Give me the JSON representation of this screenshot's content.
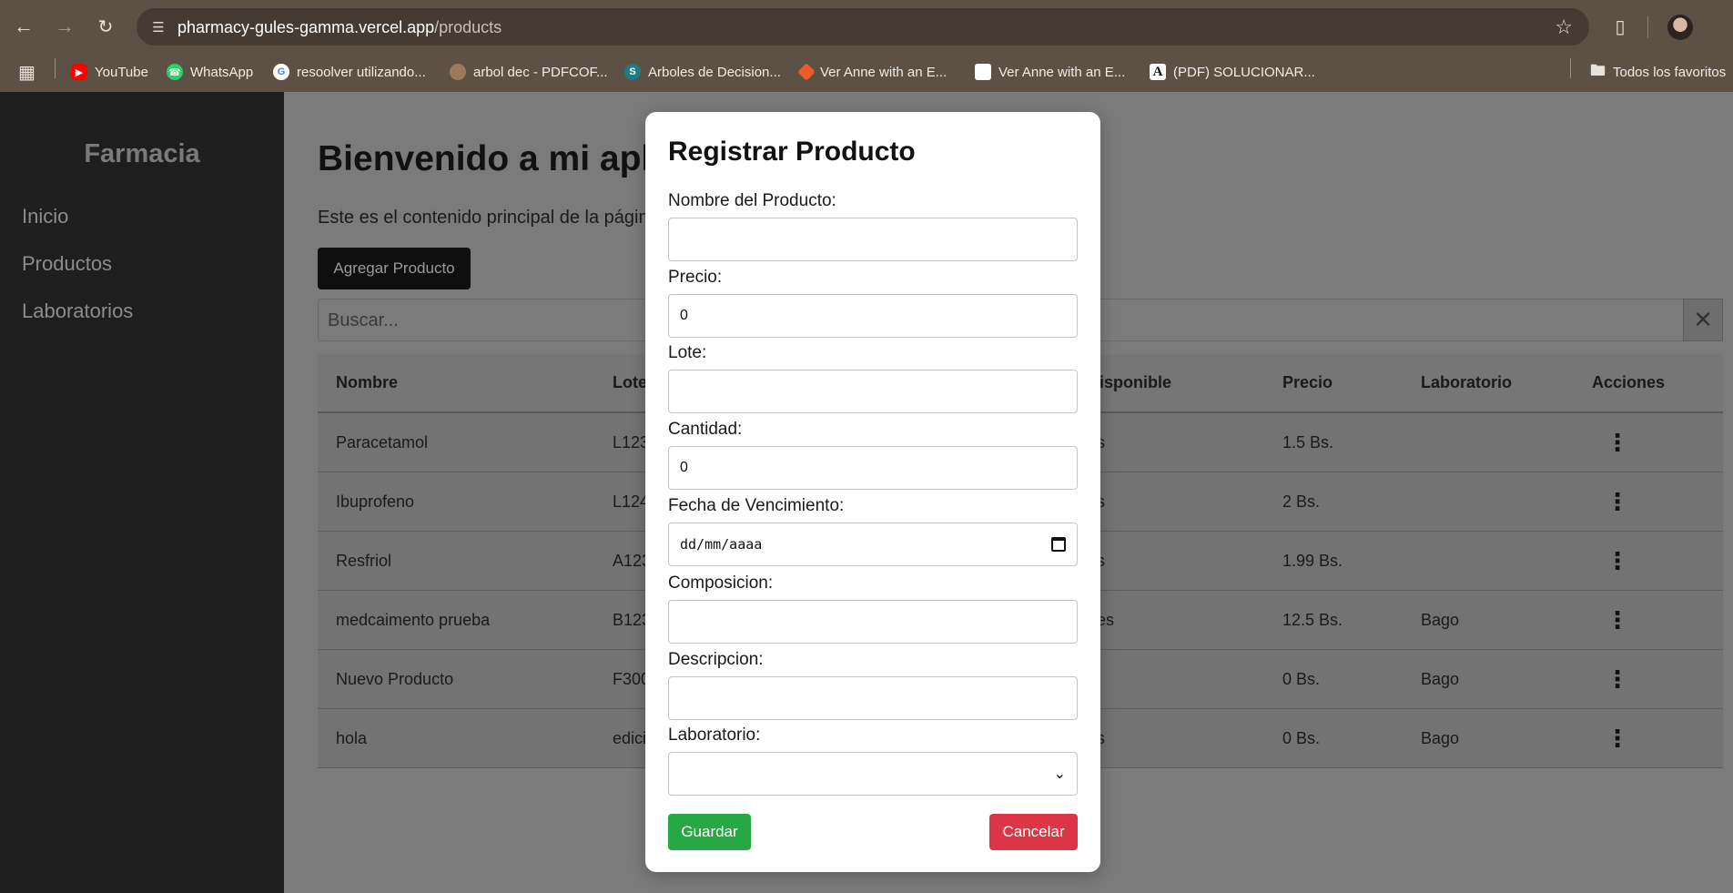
{
  "browser": {
    "url_host": "pharmacy-gules-gamma.vercel.app",
    "url_path": "/products",
    "bookmarks": [
      {
        "label": "YouTube",
        "icon": "youtube-icon",
        "color": "#ff0000"
      },
      {
        "label": "WhatsApp",
        "icon": "whatsapp-icon",
        "color": "#25d366"
      },
      {
        "label": "resoolver utilizando...",
        "icon": "google-icon",
        "color": "#ffffff"
      },
      {
        "label": "arbol dec - PDFCOF...",
        "icon": "avatar-icon",
        "color": "#a0785a"
      },
      {
        "label": "Arboles de Decision...",
        "icon": "scribd-icon",
        "color": "#1e7b85"
      },
      {
        "label": "Ver Anne with an E...",
        "icon": "diamond-icon",
        "color": "#f05a28"
      },
      {
        "label": "Ver Anne with an E...",
        "icon": "page-icon",
        "color": "#ffffff"
      },
      {
        "label": "(PDF) SOLUCIONAR...",
        "icon": "academia-icon",
        "color": "#ffffff"
      }
    ],
    "all_bookmarks_label": "Todos los favoritos"
  },
  "sidebar": {
    "brand": "Farmacia",
    "items": [
      {
        "label": "Inicio"
      },
      {
        "label": "Productos"
      },
      {
        "label": "Laboratorios"
      }
    ]
  },
  "main": {
    "welcome": "Bienvenido a mi apli",
    "lead": "Este es el contenido principal de la págin",
    "add_button": "Agregar Producto",
    "search_placeholder": "Buscar...",
    "table": {
      "headers": [
        "Nombre",
        "Lote",
        "Disponible",
        "Precio",
        "Laboratorio",
        "Acciones"
      ],
      "rows": [
        {
          "nombre": "Paracetamol",
          "lote": "L123",
          "disponible": "es",
          "precio": "1.5 Bs.",
          "laboratorio": ""
        },
        {
          "nombre": "Ibuprofeno",
          "lote": "L124",
          "disponible": "es",
          "precio": "2 Bs.",
          "laboratorio": ""
        },
        {
          "nombre": "Resfriol",
          "lote": "A123",
          "disponible": "es",
          "precio": "1.99 Bs.",
          "laboratorio": ""
        },
        {
          "nombre": "medcaimento prueba",
          "lote": "B123",
          "disponible": "des",
          "precio": "12.5 Bs.",
          "laboratorio": "Bago"
        },
        {
          "nombre": "Nuevo Producto",
          "lote": "F300",
          "disponible": "s",
          "precio": "0 Bs.",
          "laboratorio": "Bago"
        },
        {
          "nombre": "hola",
          "lote": "edici",
          "disponible": "es",
          "precio": "0 Bs.",
          "laboratorio": "Bago"
        }
      ]
    }
  },
  "modal": {
    "title": "Registrar Producto",
    "fields": {
      "nombre": {
        "label": "Nombre del Producto:",
        "value": ""
      },
      "precio": {
        "label": "Precio:",
        "value": "0"
      },
      "lote": {
        "label": "Lote:",
        "value": ""
      },
      "cantidad": {
        "label": "Cantidad:",
        "value": "0"
      },
      "fecha": {
        "label": "Fecha de Vencimiento:",
        "value": "dd/mm/aaaa"
      },
      "composicion": {
        "label": "Composicion:",
        "value": ""
      },
      "descripcion": {
        "label": "Descripcion:",
        "value": ""
      },
      "laboratorio": {
        "label": "Laboratorio:",
        "value": ""
      }
    },
    "save": "Guardar",
    "cancel": "Cancelar"
  }
}
